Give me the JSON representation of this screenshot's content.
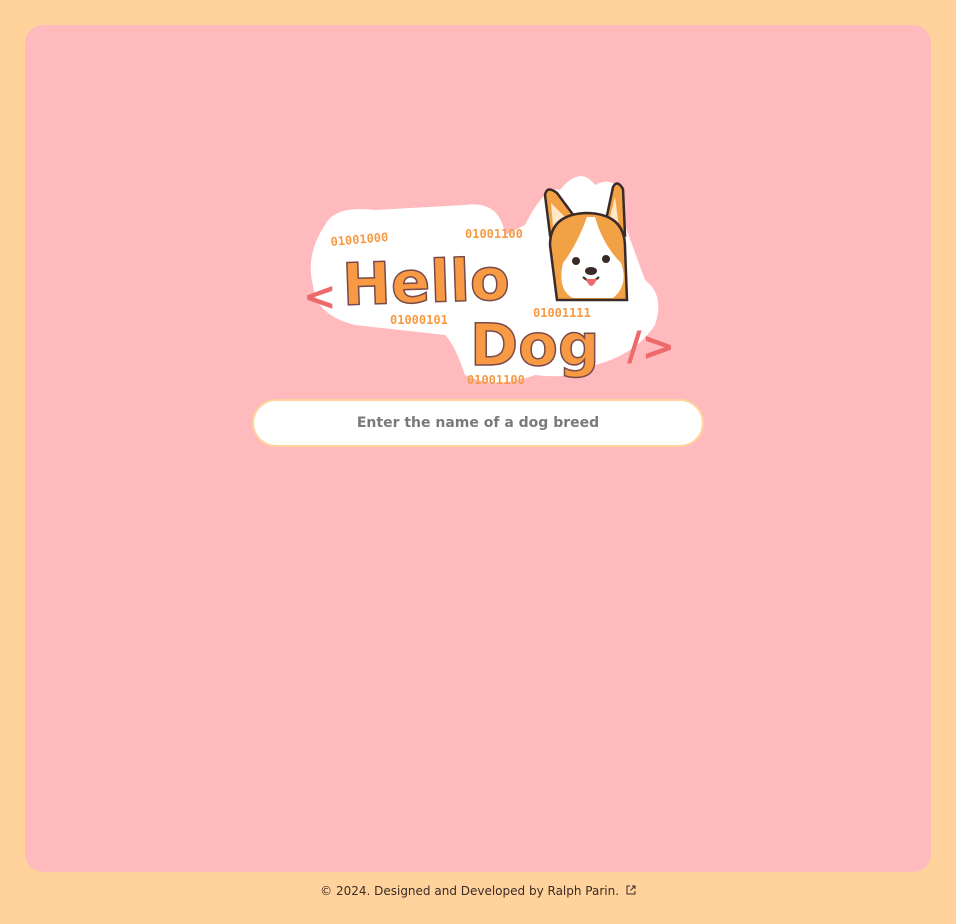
{
  "logo": {
    "line1": "Hello",
    "line2": "Dog",
    "bracket_left": "<",
    "bracket_right": "/>",
    "binary": [
      "01001000",
      "01001100",
      "01000101",
      "01001111",
      "01001100"
    ],
    "icon": "corgi-icon"
  },
  "search": {
    "placeholder": "Enter the name of a dog breed",
    "value": ""
  },
  "footer": {
    "text": "© 2024. Designed and Developed by Ralph Parin.",
    "icon": "external-link-icon"
  },
  "colors": {
    "outer_bg": "#FFD39B",
    "panel_bg": "#FFBABD",
    "logo_orange": "#F79A43",
    "logo_red": "#EC6A6A",
    "corgi_orange": "#F2A244"
  }
}
